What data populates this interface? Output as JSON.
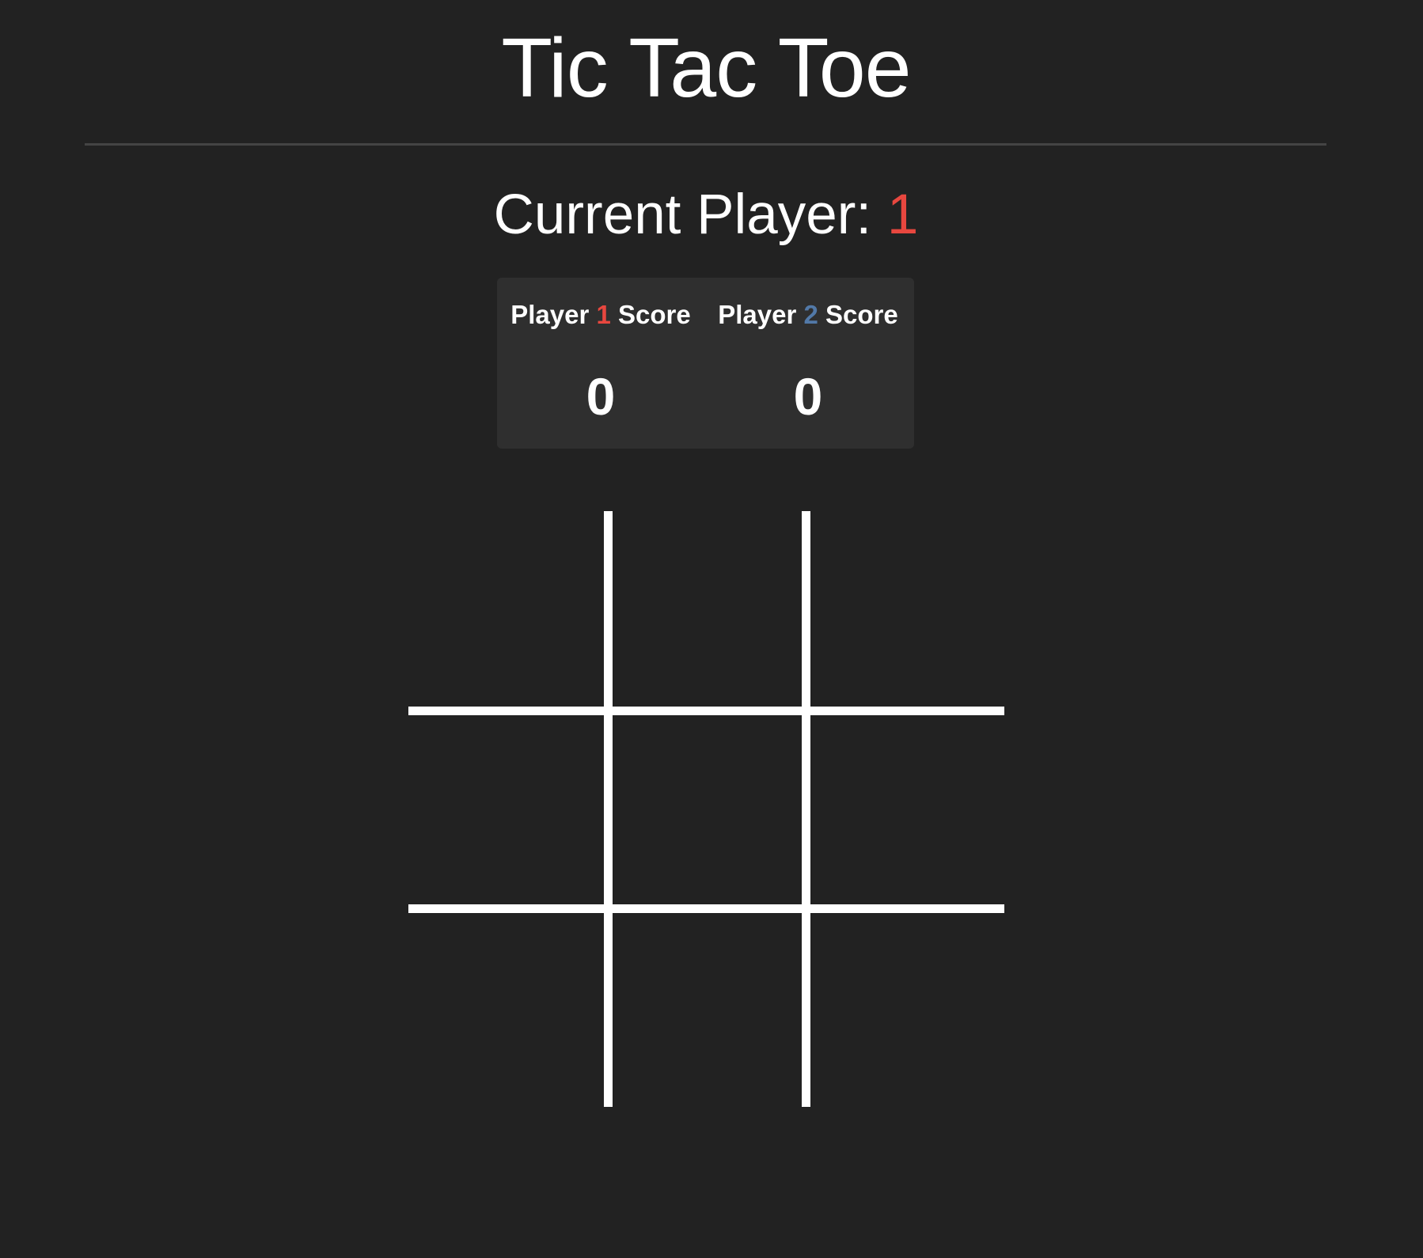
{
  "header": {
    "title": "Tic Tac Toe"
  },
  "status": {
    "current_label": "Current Player:",
    "current_player": "1"
  },
  "scoreboard": {
    "player1": {
      "prefix": "Player",
      "number": "1",
      "suffix": "Score",
      "score": "0"
    },
    "player2": {
      "prefix": "Player",
      "number": "2",
      "suffix": "Score",
      "score": "0"
    }
  },
  "board": {
    "cells": [
      "",
      "",
      "",
      "",
      "",
      "",
      "",
      "",
      ""
    ]
  },
  "colors": {
    "background": "#222222",
    "player1": "#e8473f",
    "player2": "#5279a8",
    "grid": "#ffffff",
    "scoreboard_bg": "#2f2f2f"
  }
}
